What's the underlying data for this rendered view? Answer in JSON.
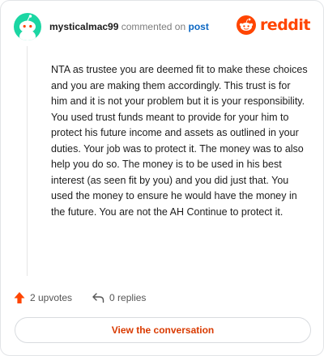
{
  "comment": {
    "username": "mysticalmac99",
    "commented_on_text": "commented on",
    "post_link_text": "post",
    "body": "NTA as trustee you are deemed fit to make these choices and you are making them accordingly. This trust is for him and it is not your problem but it is your responsibility. You used trust funds meant to provide for your him to protect his future income and assets as outlined in your duties. Your job was to protect it. The money was to also help you do so. The money is to be used in his best interest (as seen fit by you) and you did just that. You used the money to ensure he would have the money in the future. You are not the AH Continue to protect it.",
    "upvotes_label": "2 upvotes",
    "replies_label": "0 replies"
  },
  "brand": {
    "wordmark": "reddit",
    "accent_color": "#ff4500"
  },
  "cta": {
    "label": "View the conversation"
  },
  "icons": {
    "avatar": "snoo-avatar-icon",
    "logo": "reddit-snoo-icon",
    "upvote": "upvote-arrow-icon",
    "reply": "reply-arrow-icon"
  },
  "colors": {
    "avatar_bg": "#1bd6a3",
    "upvote": "#ff4500",
    "link": "#0a66c2",
    "cta_text": "#d93a00"
  }
}
